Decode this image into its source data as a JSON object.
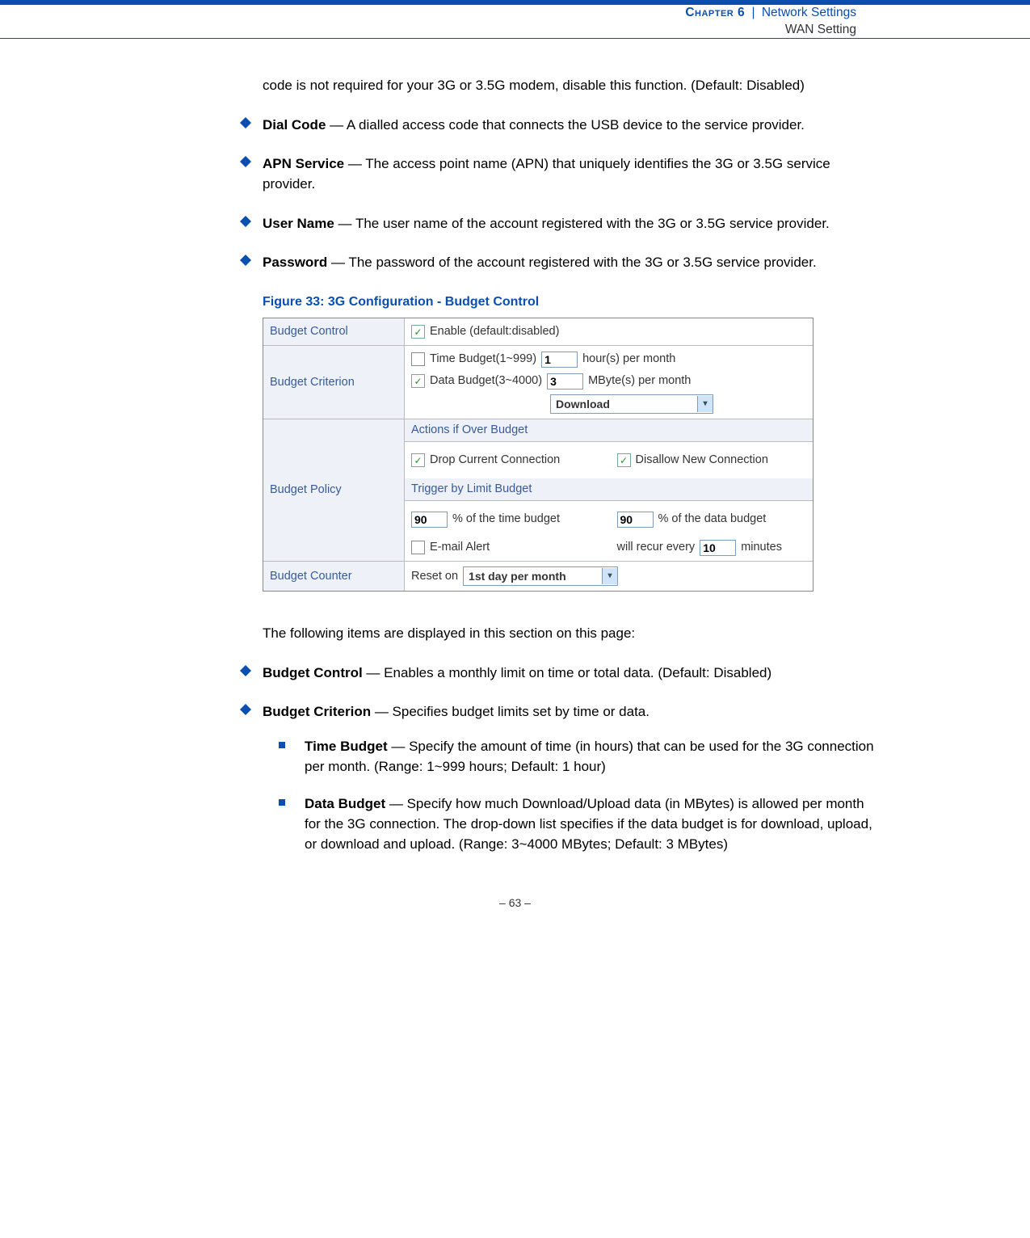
{
  "header": {
    "chapter": "Chapter 6",
    "divider": "|",
    "section": "Network Settings",
    "subsection": "WAN Setting"
  },
  "intro_para": "code is not required for your 3G or 3.5G modem, disable this function. (Default: Disabled)",
  "bullets1": [
    {
      "term": "Dial Code",
      "desc": " — A dialled access code that connects the USB device to the service provider."
    },
    {
      "term": "APN Service",
      "desc": " — The access point name (APN) that uniquely identifies the 3G or 3.5G service provider."
    },
    {
      "term": "User Name",
      "desc": " — The user name of the account registered with the 3G or 3.5G service provider."
    },
    {
      "term": "Password",
      "desc": " — The password of the account registered with the 3G or 3.5G service provider."
    }
  ],
  "figure_caption": "Figure 33:  3G Configuration - Budget Control",
  "figure": {
    "budget_control": {
      "label": "Budget Control",
      "enable_text": "Enable (default:disabled)",
      "enable_checked": true
    },
    "budget_criterion": {
      "label": "Budget Criterion",
      "time_label": "Time Budget(1~999)",
      "time_val": "1",
      "time_unit": "hour(s) per month",
      "time_checked": false,
      "data_label": "Data Budget(3~4000)",
      "data_val": "3",
      "data_unit": "MByte(s) per month",
      "data_checked": true,
      "direction": "Download"
    },
    "budget_policy": {
      "label": "Budget Policy",
      "actions_header": "Actions if Over Budget",
      "drop_label": "Drop Current Connection",
      "drop_checked": true,
      "disallow_label": "Disallow New Connection",
      "disallow_checked": true,
      "trigger_header": "Trigger by Limit Budget",
      "time_pct": "90",
      "time_pct_label": "% of the time budget",
      "data_pct": "90",
      "data_pct_label": "% of the data budget",
      "email_label": "E-mail Alert",
      "email_checked": false,
      "recur_prefix": "will recur every",
      "recur_val": "10",
      "recur_suffix": "minutes"
    },
    "budget_counter": {
      "label": "Budget Counter",
      "reset_prefix": "Reset on",
      "reset_val": "1st day per month"
    }
  },
  "mid_para": "The following items are displayed in this section on this page:",
  "bullets2": [
    {
      "term": "Budget Control",
      "desc": " — Enables a monthly limit on time or total data. (Default: Disabled)"
    },
    {
      "term": "Budget Criterion",
      "desc": " — Specifies budget limits set by time or data."
    }
  ],
  "subbullets": [
    {
      "term": "Time Budget",
      "desc": " — Specify the amount of time (in hours) that can be used for the 3G connection per month. (Range: 1~999 hours; Default: 1 hour)"
    },
    {
      "term": "Data Budget",
      "desc": " — Specify how much Download/Upload data (in MBytes) is allowed per month for the 3G connection. The drop-down list specifies if the data budget is for download, upload, or download and upload. (Range: 3~4000 MBytes; Default: 3 MBytes)"
    }
  ],
  "footer": "–  63  –"
}
